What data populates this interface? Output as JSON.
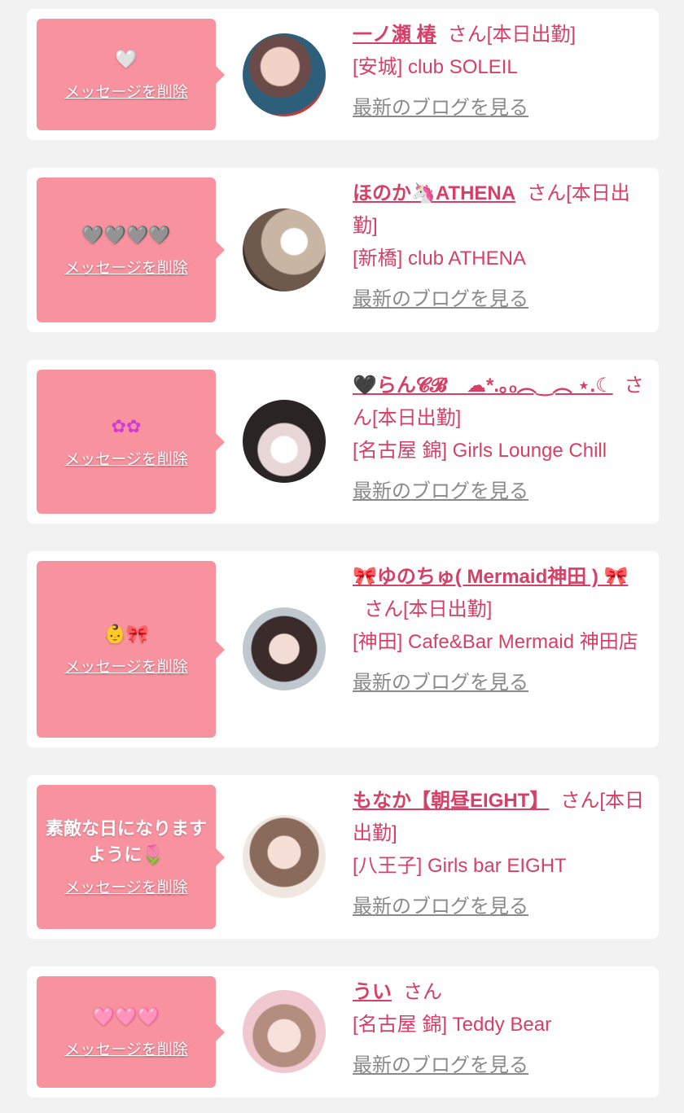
{
  "colors": {
    "background": "#f2f2f2",
    "card": "#ffffff",
    "bubble": "#f8929f",
    "accent": "#d63f66",
    "muted_link": "#8a8a8a"
  },
  "cards": [
    {
      "message": "🤍",
      "delete_label": "メッセージを削除",
      "avatar_icon": "avatar-photo",
      "name": "一ノ瀬 椿",
      "suffix": "さん[本日出勤]",
      "shop": "[安城] club SOLEIL",
      "blog_label": "最新のブログを見る"
    },
    {
      "message": "🩶🩶🩶🩶",
      "delete_label": "メッセージを削除",
      "avatar_icon": "avatar-photo",
      "name": "ほのか🦄ATHENA",
      "suffix": "さん[本日出勤]",
      "shop": "[新橋] club ATHENA",
      "blog_label": "最新のブログを見る"
    },
    {
      "message": "✿✿",
      "delete_label": "メッセージを削除",
      "avatar_icon": "avatar-photo",
      "name": "🖤らん𝓒𝓑　☁*.｡ₒ︵‿︵ ⋆.☾",
      "suffix": "さん[本日出勤]",
      "shop": "[名古屋 錦] Girls Lounge Chill",
      "blog_label": "最新のブログを見る"
    },
    {
      "message": "👶🎀",
      "delete_label": "メッセージを削除",
      "avatar_icon": "avatar-photo",
      "name": "🎀ゆのちゅ( Mermaid神田 ) 🎀",
      "suffix": "さん[本日出勤]",
      "shop": "[神田] Cafe&Bar Mermaid 神田店",
      "blog_label": "最新のブログを見る"
    },
    {
      "message": "素敵な日になりますように🌷",
      "delete_label": "メッセージを削除",
      "avatar_icon": "avatar-photo",
      "name": "もなか【朝昼EIGHT】",
      "suffix": "さん[本日出勤]",
      "shop": "[八王子] Girls bar EIGHT",
      "blog_label": "最新のブログを見る"
    },
    {
      "message": "🩷🩷🩷",
      "delete_label": "メッセージを削除",
      "avatar_icon": "avatar-photo",
      "name": "うい",
      "suffix": "さん",
      "shop": "[名古屋 錦] Teddy Bear",
      "blog_label": "最新のブログを見る"
    }
  ]
}
